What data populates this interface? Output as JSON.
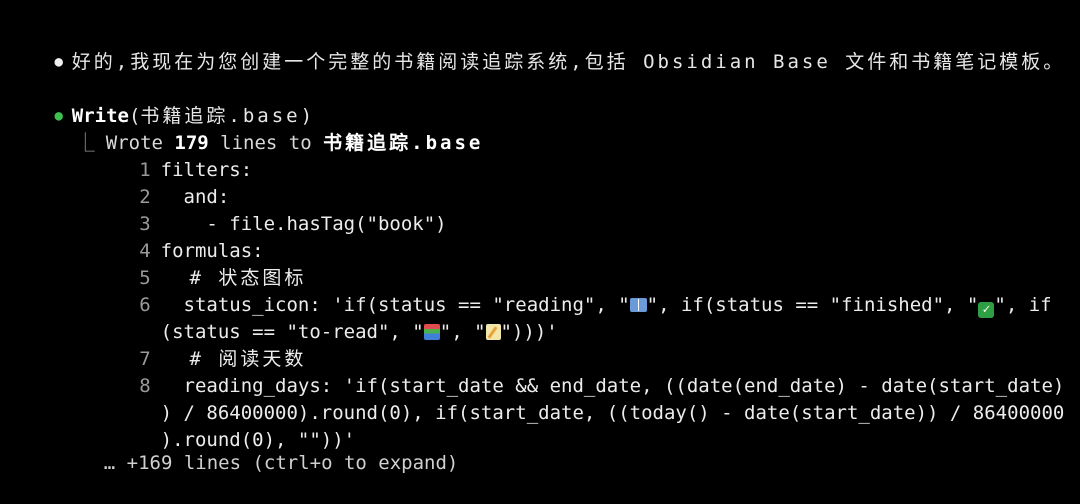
{
  "message": {
    "bullet": "●",
    "text": "好的,我现在为您创建一个完整的书籍阅读追踪系统,包括 Obsidian Base 文件和书籍笔记模板。"
  },
  "tool_call": {
    "bullet": "●",
    "name": "Write",
    "open_paren": "(",
    "argument": "书籍追踪.base",
    "close_paren": ")"
  },
  "result": {
    "branch": "⎿",
    "prefix": "Wrote ",
    "count": "179",
    "middle": " lines to ",
    "filename": "书籍追踪.base"
  },
  "code_lines": [
    {
      "num": "1",
      "text": "filters:"
    },
    {
      "num": "2",
      "text": "  and:"
    },
    {
      "num": "3",
      "text": "    - file.hasTag(\"book\")"
    },
    {
      "num": "4",
      "text": "formulas:"
    },
    {
      "num": "5",
      "text": "  # 状态图标"
    },
    {
      "num": "6",
      "text_a": "  status_icon: 'if(status == \"reading\", \"",
      "text_b": "\", if(status == \"finished\", \"",
      "text_c": "\", if",
      "text_d": "(status == \"to-read\", \"",
      "text_e": "\", \"",
      "text_f": "\")))'"
    },
    {
      "num": "7",
      "text": "  # 阅读天数"
    },
    {
      "num": "8",
      "text_a": "  reading_days: 'if(start_date && end_date, ((date(end_date) - date(start_date)",
      "text_b": ") / 86400000).round(0), if(start_date, ((today() - date(start_date)) / 86400000",
      "text_c": ").round(0), \"\"))'"
    }
  ],
  "emojis": {
    "reading": "book-open-icon",
    "finished": "check-mark-button-icon",
    "to_read": "books-icon",
    "other": "memo-icon"
  },
  "collapsed": {
    "text": "… +169 lines (ctrl+o to expand)"
  },
  "colors": {
    "background": "#000000",
    "text": "#e6e6e6",
    "bullet_green": "#3fbf4f",
    "line_number": "#9a9a9a"
  }
}
